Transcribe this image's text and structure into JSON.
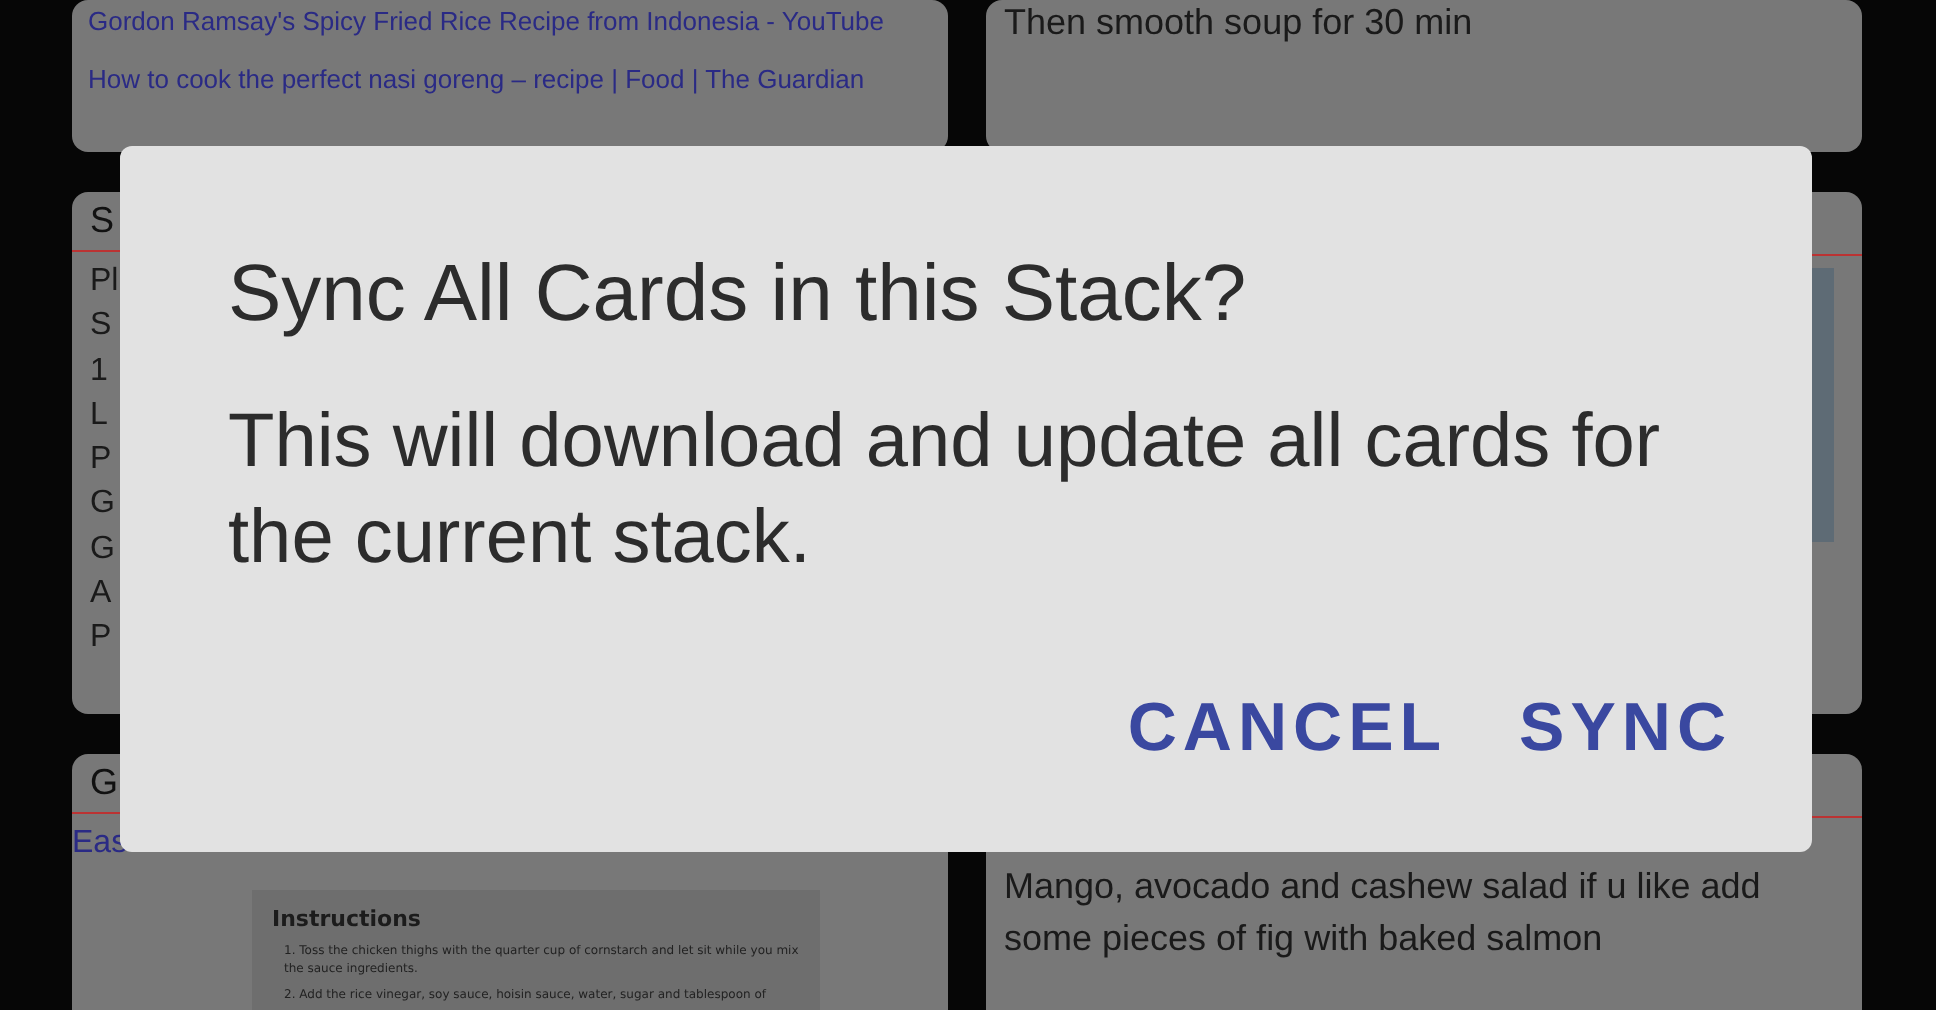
{
  "cards": [
    {
      "kind": "links",
      "links": [
        "Gordon Ramsay's Spicy Fried Rice Recipe from Indonesia - YouTube",
        "How to cook the perfect nasi goreng – recipe | Food | The Guardian"
      ]
    },
    {
      "kind": "note",
      "lines": [
        "Then smooth soup for 30 min"
      ]
    },
    {
      "kind": "list",
      "title": "S",
      "lines": [
        "Pl",
        "S",
        "1",
        "L",
        "P",
        "G",
        "G",
        "A",
        "P"
      ]
    },
    {
      "kind": "photo"
    },
    {
      "kind": "document",
      "title": "G",
      "links": [
        "Eas"
      ],
      "doc": {
        "heading": "Instructions",
        "steps": [
          "1. Toss the chicken thighs with the quarter cup of cornstarch and let sit while you mix the sauce ingredients.",
          "2. Add the rice vinegar, soy sauce, hoisin sauce, water, sugar and tablespoon of"
        ]
      }
    },
    {
      "kind": "titled-note",
      "lines": [
        "Mango, avocado and cashew salad if u like add some pieces of fig with baked salmon"
      ]
    }
  ],
  "dialog": {
    "title": "Sync All Cards in this Stack?",
    "message": "This will download and update all cards for the current stack.",
    "buttons": [
      "CANCEL",
      "SYNC"
    ]
  }
}
